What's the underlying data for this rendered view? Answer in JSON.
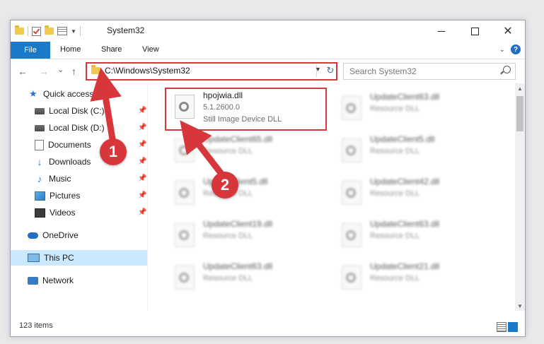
{
  "window": {
    "title": "System32",
    "controls": {
      "minimize": "",
      "maximize": "",
      "close": "✕"
    }
  },
  "ribbon": {
    "file": "File",
    "tabs": [
      "Home",
      "Share",
      "View"
    ],
    "help": "?"
  },
  "nav": {
    "back": "←",
    "forward": "→",
    "recent": "⌄",
    "up": "↑",
    "address": "C:\\Windows\\System32",
    "dropdown": "▼",
    "refresh": "↻",
    "search_placeholder": "Search System32"
  },
  "sidebar": {
    "items": [
      {
        "label": "Quick access",
        "icon": "star-icon",
        "pinned": false
      },
      {
        "label": "Local Disk (C:)",
        "icon": "disk-icon",
        "pinned": true
      },
      {
        "label": "Local Disk (D:)",
        "icon": "disk-icon",
        "pinned": true
      },
      {
        "label": "Documents",
        "icon": "documents-icon",
        "pinned": true
      },
      {
        "label": "Downloads",
        "icon": "download-icon",
        "pinned": true
      },
      {
        "label": "Music",
        "icon": "music-icon",
        "pinned": true
      },
      {
        "label": "Pictures",
        "icon": "pictures-icon",
        "pinned": true
      },
      {
        "label": "Videos",
        "icon": "videos-icon",
        "pinned": true
      },
      {
        "label": "OneDrive",
        "icon": "cloud-icon",
        "pinned": false
      },
      {
        "label": "This PC",
        "icon": "computer-icon",
        "pinned": false,
        "selected": true
      },
      {
        "label": "Network",
        "icon": "network-icon",
        "pinned": false
      }
    ]
  },
  "files": {
    "highlighted": {
      "name": "hpojwia.dll",
      "version": "5.1.2600.0",
      "description": "Still Image Device DLL"
    },
    "left_column": [
      {
        "name": "UpdateClient65.dll",
        "description": "Resource DLL"
      },
      {
        "name": "UpdateClient5.dll",
        "description": "Resource DLL"
      },
      {
        "name": "UpdateClient19.dll",
        "description": "Resource DLL"
      },
      {
        "name": "UpdateClient63.dll",
        "description": "Resource DLL"
      }
    ],
    "right_column": [
      {
        "name": "UpdateClient63.dll",
        "description": "Resource DLL"
      },
      {
        "name": "UpdateClient5.dll",
        "description": "Resource DLL"
      },
      {
        "name": "UpdateClient42.dll",
        "description": "Resource DLL"
      },
      {
        "name": "UpdateClient63.dll",
        "description": "Resource DLL"
      },
      {
        "name": "UpdateClient21.dll",
        "description": "Resource DLL"
      }
    ]
  },
  "status": {
    "item_count": "123 items"
  },
  "callouts": {
    "one": "1",
    "two": "2"
  },
  "colors": {
    "accent": "#1979ca",
    "highlight": "#d7363a",
    "selected": "#cce8ff"
  }
}
